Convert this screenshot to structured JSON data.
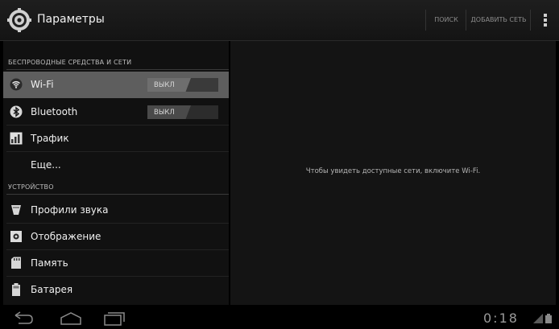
{
  "app": {
    "title": "Параметры",
    "icon": "gear-icon"
  },
  "actionbar": {
    "search_label": "ПОИСК",
    "add_network_label": "ДОБАВИТЬ СЕТЬ"
  },
  "categories": {
    "wireless": "БЕСПРОВОДНЫЕ СРЕДСТВА И СЕТИ",
    "device": "УСТРОЙСТВО"
  },
  "items": {
    "wifi": {
      "label": "Wi-Fi",
      "toggle": "ВЫКЛ",
      "icon": "wifi-icon",
      "selected": true
    },
    "bluetooth": {
      "label": "Bluetooth",
      "toggle": "ВЫКЛ",
      "icon": "bluetooth-icon"
    },
    "traffic": {
      "label": "Трафик",
      "icon": "chart-icon"
    },
    "more": {
      "label": "Еще..."
    },
    "sound": {
      "label": "Профили звука",
      "icon": "sound-profile-icon"
    },
    "display": {
      "label": "Отображение",
      "icon": "display-icon"
    },
    "storage": {
      "label": "Память",
      "icon": "storage-icon"
    },
    "battery": {
      "label": "Батарея",
      "icon": "battery-icon"
    }
  },
  "detail": {
    "message": "Чтобы увидеть доступные сети, включите Wi-Fi."
  },
  "statusbar": {
    "time": "0:18"
  },
  "colors": {
    "background": "#000000",
    "selected_row": "#5e5e5e",
    "panel": "#141414"
  }
}
